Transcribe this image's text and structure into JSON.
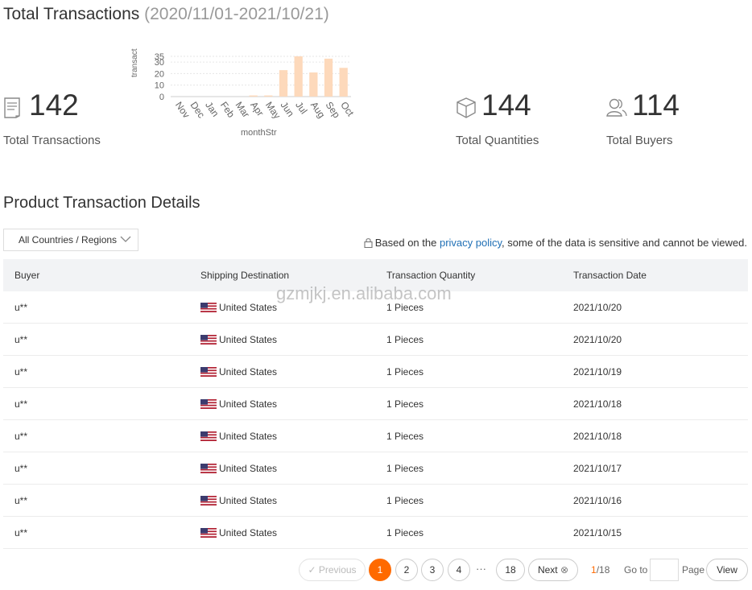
{
  "header": {
    "title": "Total Transactions",
    "date_range": "(2020/11/01-2021/10/21)"
  },
  "stats": [
    {
      "value": "142",
      "label": "Total Transactions",
      "icon": "document-icon"
    },
    {
      "value": "144",
      "label": "Total Quantities",
      "icon": "box-icon"
    },
    {
      "value": "114",
      "label": "Total Buyers",
      "icon": "users-icon"
    }
  ],
  "chart_data": {
    "type": "bar",
    "categories": [
      "Nov",
      "Dec",
      "Jan",
      "Feb",
      "Mar",
      "Apr",
      "May",
      "Jun",
      "Jul",
      "Aug",
      "Sep",
      "Oct"
    ],
    "values": [
      0,
      0,
      0,
      0,
      0,
      1,
      1,
      23,
      35,
      21,
      33,
      25
    ],
    "xlabel": "monthStr",
    "ylabel": "transact",
    "ylim": [
      0,
      35
    ],
    "yticks": [
      "0",
      "10",
      "20",
      "30",
      "35"
    ],
    "grid": true,
    "bar_color": "#fdd9bb"
  },
  "details": {
    "title": "Product Transaction Details",
    "region_filter": "All Countries / Regions",
    "notice_prefix": "Based on the ",
    "notice_link": "privacy policy",
    "notice_suffix": ", some of the data is sensitive and cannot be viewed."
  },
  "table": {
    "headers": [
      "Buyer",
      "Shipping Destination",
      "Transaction Quantity",
      "Transaction Date"
    ],
    "rows": [
      {
        "buyer": "u**",
        "destination": "United States",
        "quantity": "1 Pieces",
        "date": "2021/10/20"
      },
      {
        "buyer": "u**",
        "destination": "United States",
        "quantity": "1 Pieces",
        "date": "2021/10/20"
      },
      {
        "buyer": "u**",
        "destination": "United States",
        "quantity": "1 Pieces",
        "date": "2021/10/19"
      },
      {
        "buyer": "u**",
        "destination": "United States",
        "quantity": "1 Pieces",
        "date": "2021/10/18"
      },
      {
        "buyer": "u**",
        "destination": "United States",
        "quantity": "1 Pieces",
        "date": "2021/10/18"
      },
      {
        "buyer": "u**",
        "destination": "United States",
        "quantity": "1 Pieces",
        "date": "2021/10/17"
      },
      {
        "buyer": "u**",
        "destination": "United States",
        "quantity": "1 Pieces",
        "date": "2021/10/16"
      },
      {
        "buyer": "u**",
        "destination": "United States",
        "quantity": "1 Pieces",
        "date": "2021/10/15"
      }
    ]
  },
  "watermark": "gzmjkj.en.alibaba.com",
  "pagination": {
    "previous": "Previous",
    "pages": [
      "1",
      "2",
      "3",
      "4"
    ],
    "ellipsis": "···",
    "last_page": "18",
    "next": "Next",
    "current": "1",
    "total": "/18",
    "goto_label": "Go to",
    "page_label": "Page",
    "view_label": "View",
    "accent": "#ff6a00"
  }
}
